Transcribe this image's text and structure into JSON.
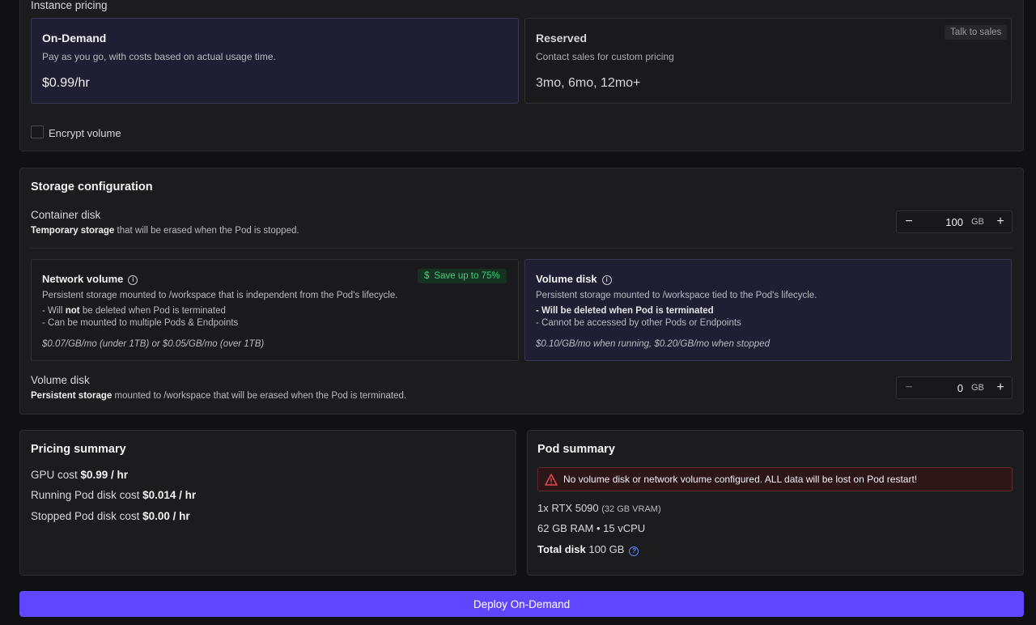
{
  "instance_pricing": {
    "label": "Instance pricing",
    "on_demand": {
      "title": "On-Demand",
      "description": "Pay as you go, with costs based on actual usage time.",
      "price": "$0.99/hr"
    },
    "reserved": {
      "title": "Reserved",
      "description": "Contact sales for custom pricing",
      "price": "3mo, 6mo, 12mo+",
      "badge": "Talk to sales"
    },
    "encrypt_label": "Encrypt volume"
  },
  "storage": {
    "title": "Storage configuration",
    "container_disk": {
      "label": "Container disk",
      "desc_strong": "Temporary storage",
      "desc_rest": " that will be erased when the Pod is stopped.",
      "value": "100",
      "unit": "GB"
    },
    "network_volume": {
      "title": "Network volume",
      "badge": "Save up to 75%",
      "description": "Persistent storage mounted to /workspace that is independent from the Pod's lifecycle.",
      "bullet1_a": "- Will ",
      "bullet1_b": "not",
      "bullet1_c": " be deleted when Pod is terminated",
      "bullet2": "- Can be mounted to multiple Pods & Endpoints",
      "price": "$0.07/GB/mo (under 1TB) or $0.05/GB/mo (over 1TB)"
    },
    "volume_card": {
      "title": "Volume disk",
      "description": "Persistent storage mounted to /workspace tied to the Pod's lifecycle.",
      "bullet1": "- Will be deleted when Pod is terminated",
      "bullet2": "- Cannot be accessed by other Pods or Endpoints",
      "price": "$0.10/GB/mo when running, $0.20/GB/mo when stopped"
    },
    "volume_disk": {
      "label": "Volume disk",
      "desc_strong": "Persistent storage",
      "desc_rest": " mounted to /workspace that will be erased when the Pod is terminated.",
      "value": "0",
      "unit": "GB"
    }
  },
  "pricing_summary": {
    "title": "Pricing summary",
    "gpu_label": "GPU cost ",
    "gpu_value": "$0.99 / hr",
    "running_label": "Running Pod disk cost ",
    "running_value": "$0.014 / hr",
    "stopped_label": "Stopped Pod disk cost ",
    "stopped_value": "$0.00 / hr"
  },
  "pod_summary": {
    "title": "Pod summary",
    "warning": "No volume disk or network volume configured. ALL data will be lost on Pod restart!",
    "gpu": "1x RTX 5090",
    "vram": "(32 GB VRAM)",
    "specs": "62 GB RAM • 15 vCPU",
    "total_label": "Total disk",
    "total_value": "100 GB"
  },
  "deploy_label": "Deploy On-Demand",
  "colors": {
    "accent": "#6046ff",
    "save_green": "#3fcf7a",
    "warning_red": "#e5484d",
    "info_blue": "#5b8cff"
  }
}
